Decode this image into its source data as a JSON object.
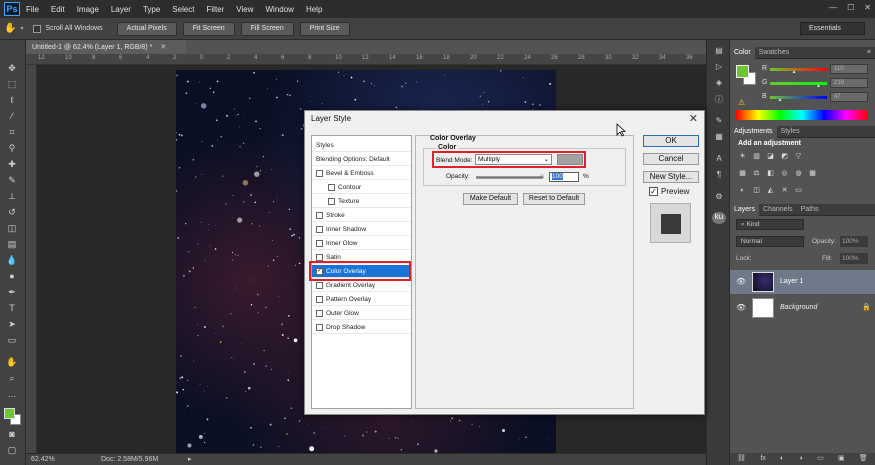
{
  "app": {
    "logo": "Ps"
  },
  "menu": [
    "File",
    "Edit",
    "Image",
    "Layer",
    "Type",
    "Select",
    "Filter",
    "View",
    "Window",
    "Help"
  ],
  "window_controls": [
    "—",
    "☐",
    "✕"
  ],
  "options_bar": {
    "tool_icon": "hand-icon",
    "scroll_all_windows": "Scroll All Windows",
    "actual_pixels": "Actual Pixels",
    "fit_screen": "Fit Screen",
    "fill_screen": "Fill Screen",
    "print_size": "Print Size",
    "workspace": "Essentials"
  },
  "document": {
    "tab_title": "Untitled-1 @ 62.4% (Layer 1, RGB/8) *",
    "zoom": "62.42%",
    "doc_info": "Doc: 2.58M/5.96M"
  },
  "ruler_labels": [
    "12",
    "10",
    "8",
    "6",
    "4",
    "2",
    "0",
    "2",
    "4",
    "6",
    "8",
    "10",
    "12",
    "14",
    "16",
    "18",
    "20",
    "22",
    "24",
    "26",
    "28",
    "30",
    "32",
    "34",
    "36"
  ],
  "color_panel": {
    "tabs": [
      "Color",
      "Swatches"
    ],
    "fg_color": "#6ec534",
    "bg_color": "#ffffff",
    "channels": [
      {
        "name": "R",
        "value": "110",
        "gradient": "#ff0000"
      },
      {
        "name": "G",
        "value": "219",
        "gradient": "#00ff00"
      },
      {
        "name": "B",
        "value": "47",
        "gradient": "#0000ff"
      }
    ]
  },
  "adjustments_panel": {
    "tabs": [
      "Adjustments",
      "Styles"
    ],
    "heading": "Add an adjustment",
    "icons_row1": [
      "brightness-icon",
      "levels-icon",
      "curves-icon",
      "exposure-icon",
      "vibrance-icon"
    ],
    "icons_row2": [
      "hue-saturation-icon",
      "color-balance-icon",
      "black-white-icon",
      "photo-filter-icon",
      "channel-mixer-icon",
      "color-lookup-icon"
    ],
    "icons_row3": [
      "invert-icon",
      "posterize-icon",
      "threshold-icon",
      "selective-color-icon",
      "gradient-map-icon"
    ]
  },
  "layers_panel": {
    "tabs": [
      "Layers",
      "Channels",
      "Paths"
    ],
    "filter_kind": "Kind",
    "blend_mode": "Normal",
    "opacity_label": "Opacity:",
    "opacity_value": "100%",
    "lock_label": "Lock:",
    "fill_label": "Fill:",
    "fill_value": "100%",
    "layers": [
      {
        "name": "Layer 1",
        "selected": true
      },
      {
        "name": "Background",
        "selected": false
      }
    ]
  },
  "dialog": {
    "title": "Layer Style",
    "close": "✕",
    "styles": [
      {
        "label": "Styles",
        "checkbox": false,
        "indent": false,
        "checked": false,
        "selected": false
      },
      {
        "label": "Blending Options: Default",
        "checkbox": false,
        "indent": false,
        "checked": false,
        "selected": false
      },
      {
        "label": "Bevel & Emboss",
        "checkbox": true,
        "indent": false,
        "checked": false,
        "selected": false
      },
      {
        "label": "Contour",
        "checkbox": true,
        "indent": true,
        "checked": false,
        "selected": false
      },
      {
        "label": "Texture",
        "checkbox": true,
        "indent": true,
        "checked": false,
        "selected": false
      },
      {
        "label": "Stroke",
        "checkbox": true,
        "indent": false,
        "checked": false,
        "selected": false
      },
      {
        "label": "Inner Shadow",
        "checkbox": true,
        "indent": false,
        "checked": false,
        "selected": false
      },
      {
        "label": "Inner Glow",
        "checkbox": true,
        "indent": false,
        "checked": false,
        "selected": false
      },
      {
        "label": "Satin",
        "checkbox": true,
        "indent": false,
        "checked": false,
        "selected": false
      },
      {
        "label": "Color Overlay",
        "checkbox": true,
        "indent": false,
        "checked": true,
        "selected": true
      },
      {
        "label": "Gradient Overlay",
        "checkbox": true,
        "indent": false,
        "checked": false,
        "selected": false
      },
      {
        "label": "Pattern Overlay",
        "checkbox": true,
        "indent": false,
        "checked": false,
        "selected": false
      },
      {
        "label": "Outer Glow",
        "checkbox": true,
        "indent": false,
        "checked": false,
        "selected": false
      },
      {
        "label": "Drop Shadow",
        "checkbox": true,
        "indent": false,
        "checked": false,
        "selected": false
      }
    ],
    "section_title": "Color Overlay",
    "group_title": "Color",
    "blend_mode_label": "Blend Mode:",
    "blend_mode_value": "Multiply",
    "overlay_color": "#a2a2a2",
    "opacity_label": "Opacity:",
    "opacity_value": "100",
    "opacity_unit": "%",
    "opacity_level": 1.0,
    "make_default": "Make Default",
    "reset_default": "Reset to Default",
    "ok": "OK",
    "cancel": "Cancel",
    "new_style": "New Style...",
    "preview_label": "Preview",
    "preview_checked": true
  }
}
